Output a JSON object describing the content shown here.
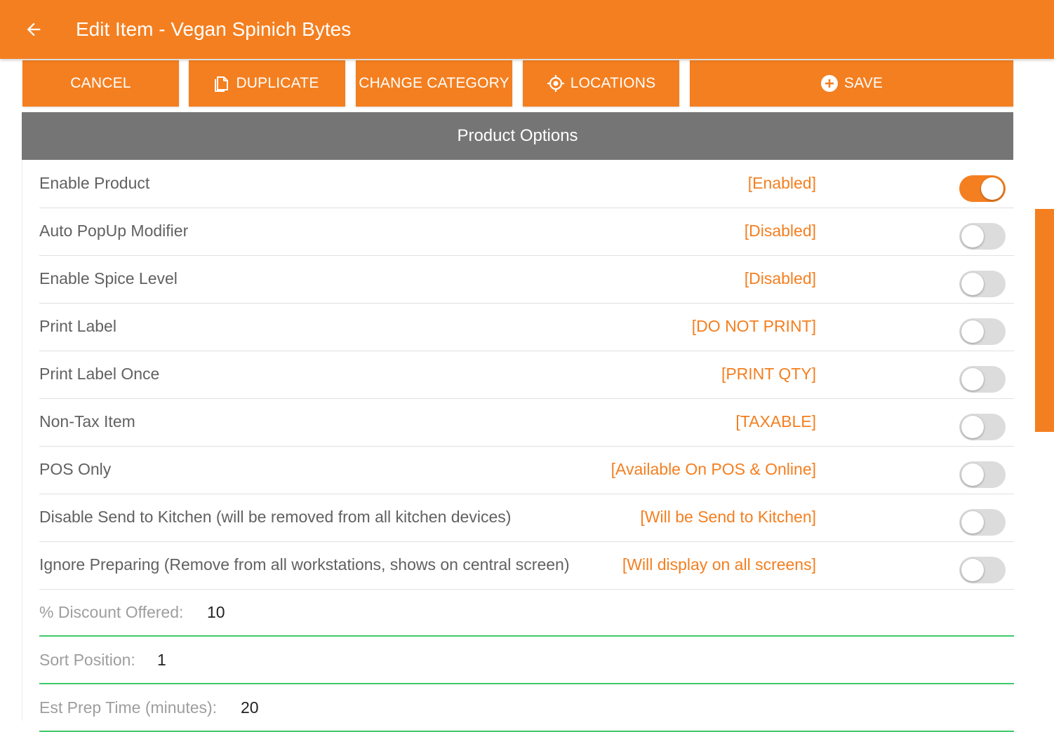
{
  "appbar": {
    "title": "Edit Item - Vegan Spinich Bytes",
    "back_icon": "arrow-left-icon"
  },
  "actions": {
    "cancel": "CANCEL",
    "duplicate": "DUPLICATE",
    "change_category": "CHANGE CATEGORY",
    "locations": "LOCATIONS",
    "save": "SAVE"
  },
  "panel": {
    "title": "Product Options"
  },
  "options": [
    {
      "label": "Enable Product",
      "status": "[Enabled]",
      "on": true
    },
    {
      "label": "Auto PopUp Modifier",
      "status": "[Disabled]",
      "on": false
    },
    {
      "label": "Enable Spice Level",
      "status": "[Disabled]",
      "on": false
    },
    {
      "label": "Print Label",
      "status": "[DO NOT PRINT]",
      "on": false
    },
    {
      "label": "Print Label Once",
      "status": "[PRINT QTY]",
      "on": false
    },
    {
      "label": "Non-Tax Item",
      "status": "[TAXABLE]",
      "on": false
    },
    {
      "label": "POS Only",
      "status": "[Available On POS & Online]",
      "on": false
    },
    {
      "label": "Disable Send to Kitchen (will be removed from all kitchen devices)",
      "status": "[Will be Send to Kitchen]",
      "on": false
    },
    {
      "label": "Ignore Preparing (Remove from all workstations, shows on central screen)",
      "status": "[Will display on all screens]",
      "on": false
    }
  ],
  "fields": [
    {
      "label": "% Discount Offered:",
      "value": "10"
    },
    {
      "label": "Sort Position:",
      "value": "1"
    },
    {
      "label": "Est Prep Time (minutes):",
      "value": "20"
    }
  ],
  "colors": {
    "accent": "#f47f20",
    "header_grey": "#757575",
    "field_underline": "#3ec96a"
  }
}
